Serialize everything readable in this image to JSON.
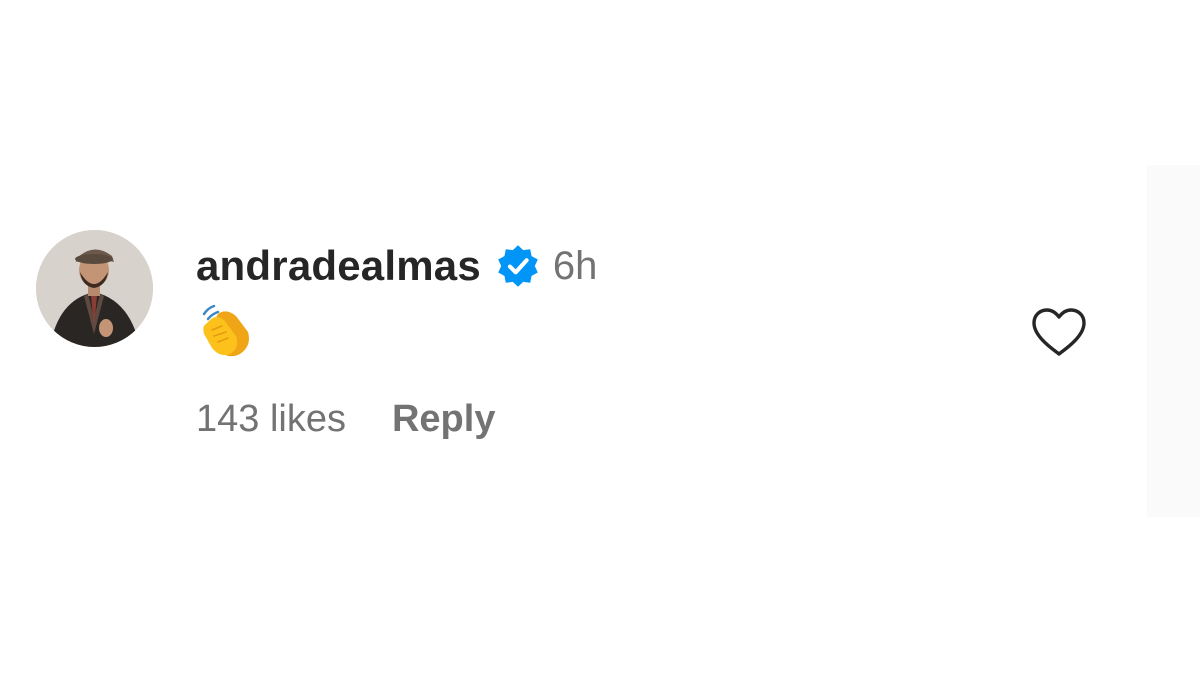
{
  "comment": {
    "username": "andradealmas",
    "verified_icon": "verified-badge-icon",
    "timestamp": "6h",
    "text_emoji": "clapping-hands-icon",
    "likes_label": "143 likes",
    "reply_label": "Reply",
    "like_icon": "heart-outline-icon"
  },
  "colors": {
    "username": "#262626",
    "secondary_text": "#737373",
    "verified_blue": "#0095f6",
    "background": "#ffffff"
  }
}
